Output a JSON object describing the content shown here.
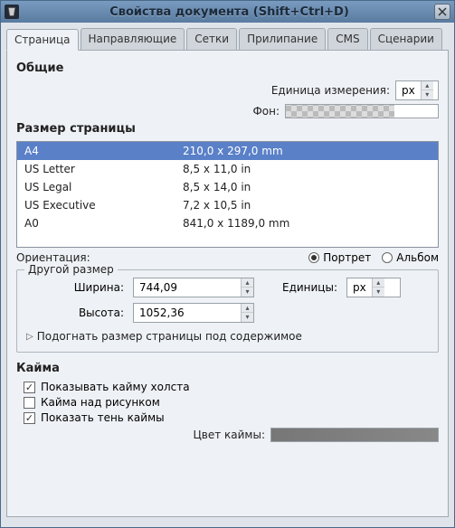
{
  "window": {
    "title": "Свойства документа (Shift+Ctrl+D)"
  },
  "tabs": [
    "Страница",
    "Направляющие",
    "Сетки",
    "Прилипание",
    "CMS",
    "Сценарии"
  ],
  "general": {
    "heading": "Общие",
    "unit_label": "Единица измерения:",
    "unit_value": "px",
    "bg_label": "Фон:"
  },
  "pagesize": {
    "heading": "Размер страницы",
    "items": [
      {
        "name": "A4",
        "dim": "210,0 x 297,0 mm",
        "selected": true
      },
      {
        "name": "US Letter",
        "dim": "8,5 x 11,0 in"
      },
      {
        "name": "US Legal",
        "dim": "8,5 x 14,0 in"
      },
      {
        "name": "US Executive",
        "dim": "7,2 x 10,5 in"
      },
      {
        "name": "A0",
        "dim": "841,0 x 1189,0 mm"
      }
    ],
    "orientation_label": "Ориентация:",
    "portrait": "Портрет",
    "landscape": "Альбом"
  },
  "custom": {
    "legend": "Другой размер",
    "width_label": "Ширина:",
    "width_value": "744,09",
    "height_label": "Высота:",
    "height_value": "1052,36",
    "units_label": "Единицы:",
    "units_value": "px",
    "fit": "Подогнать размер страницы под содержимое"
  },
  "border": {
    "heading": "Кайма",
    "show_border": "Показывать кайму холста",
    "border_on_top": "Кайма над рисунком",
    "show_shadow": "Показать тень каймы",
    "color_label": "Цвет каймы:"
  }
}
